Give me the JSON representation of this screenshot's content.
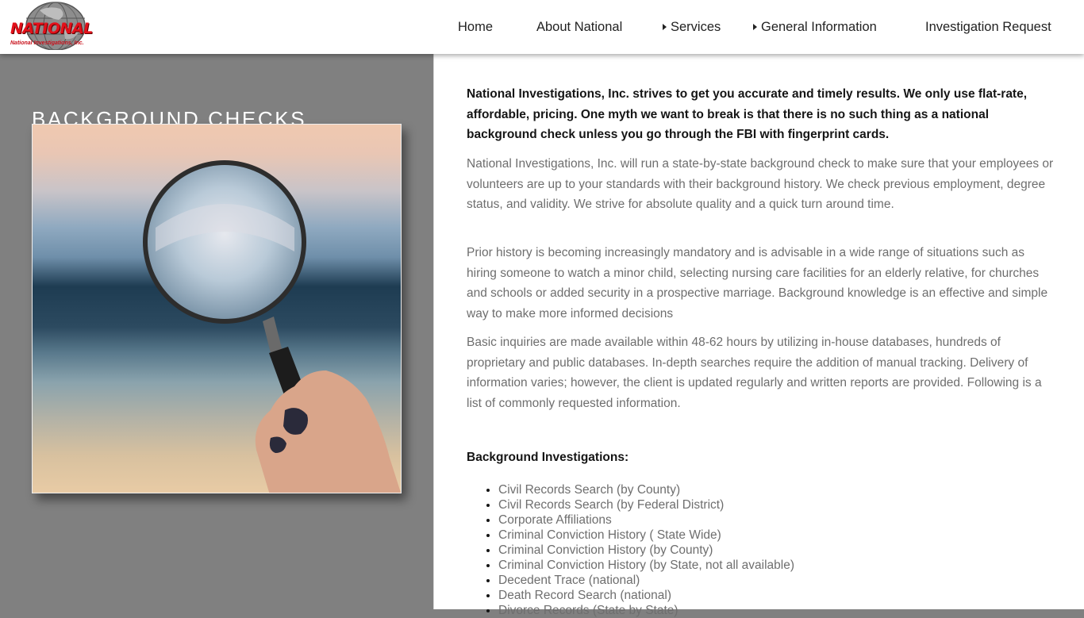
{
  "logo": {
    "text": "NATIONAL",
    "subtext": "National Investigations, Inc."
  },
  "nav": {
    "home": "Home",
    "about": "About National",
    "services": "Services",
    "general_info": "General Information",
    "investigation_request": "Investigation Request"
  },
  "left": {
    "title": "BACKGROUND CHECKS"
  },
  "content": {
    "intro": "National Investigations, Inc. strives to get you accurate and timely results.  We only use flat-rate, affordable, pricing.  One myth we want to break is that there is no such thing as a national background check unless you go through the FBI with fingerprint cards.",
    "para1": "National Investigations, Inc. will run a state-by-state background check  to make sure that your employees or volunteers are up to your standards with their background history.  We check previous employment, degree status, and validity.  We strive for absolute quality and a quick turn around time.",
    "para2": "Prior history is becoming increasingly mandatory and is advisable in a wide range of situations such as hiring someone to watch a minor child, selecting nursing care facilities for an elderly relative, for churches and schools or added security in a prospective marriage. Background knowledge is an effective and simple way to make more informed decisions",
    "para3": "Basic inquiries are made available within 48-62 hours by utilizing in-house databases, hundreds of proprietary and public databases. In-depth searches require the addition of manual tracking. Delivery of information varies; however, the client is updated regularly and written reports are provided. Following is a list of commonly requested information.",
    "section_heading": "Background Investigations:",
    "list_items": [
      "Civil Records Search (by County)",
      "Civil Records Search (by Federal District)",
      "Corporate Affiliations",
      "Criminal Conviction History ( State Wide)",
      "Criminal Conviction History (by County)",
      "Criminal Conviction History (by State, not all available)",
      "Decedent Trace (national)",
      "Death Record Search (national)",
      "Divorce Records (State by State)"
    ]
  },
  "colors": {
    "left_panel": "#808080",
    "logo_red": "#e3101a",
    "text_dark": "#151515",
    "text_gray": "#6e6e6e"
  }
}
